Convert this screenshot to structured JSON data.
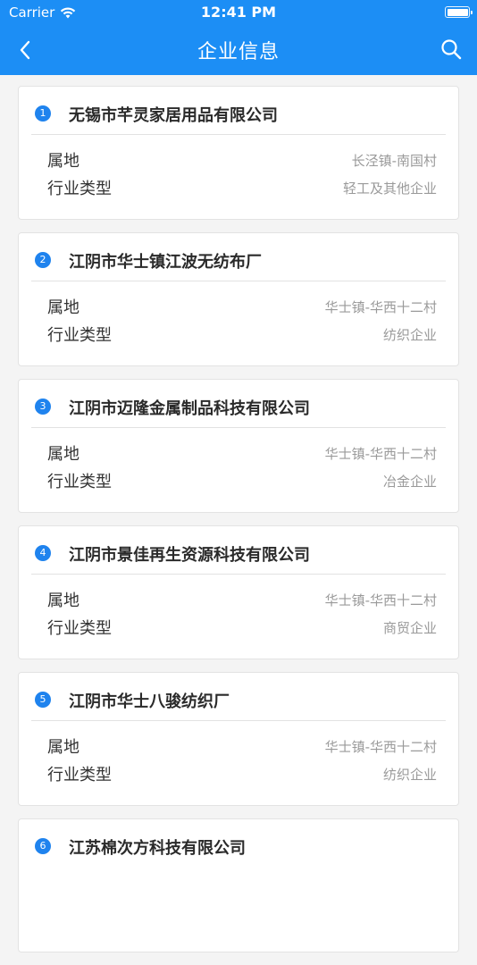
{
  "status_bar": {
    "carrier": "Carrier",
    "time": "12:41 PM"
  },
  "nav": {
    "title": "企业信息",
    "back_icon": "chevron-left-icon",
    "search_icon": "search-icon"
  },
  "theme": {
    "primary": "#1c8ef5",
    "index_badge": "#1f83ee"
  },
  "labels": {
    "location": "属地",
    "industry": "行业类型"
  },
  "companies": [
    {
      "index": "1",
      "name": "无锡市芊灵家居用品有限公司",
      "location": "长泾镇-南国村",
      "industry": "轻工及其他企业"
    },
    {
      "index": "2",
      "name": "江阴市华士镇江波无纺布厂",
      "location": "华士镇-华西十二村",
      "industry": "纺织企业"
    },
    {
      "index": "3",
      "name": "江阴市迈隆金属制品科技有限公司",
      "location": "华士镇-华西十二村",
      "industry": "冶金企业"
    },
    {
      "index": "4",
      "name": "江阴市景佳再生资源科技有限公司",
      "location": "华士镇-华西十二村",
      "industry": "商贸企业"
    },
    {
      "index": "5",
      "name": "江阴市华士八骏纺织厂",
      "location": "华士镇-华西十二村",
      "industry": "纺织企业"
    },
    {
      "index": "6",
      "name": "江苏棉次方科技有限公司",
      "location": "",
      "industry": ""
    }
  ]
}
